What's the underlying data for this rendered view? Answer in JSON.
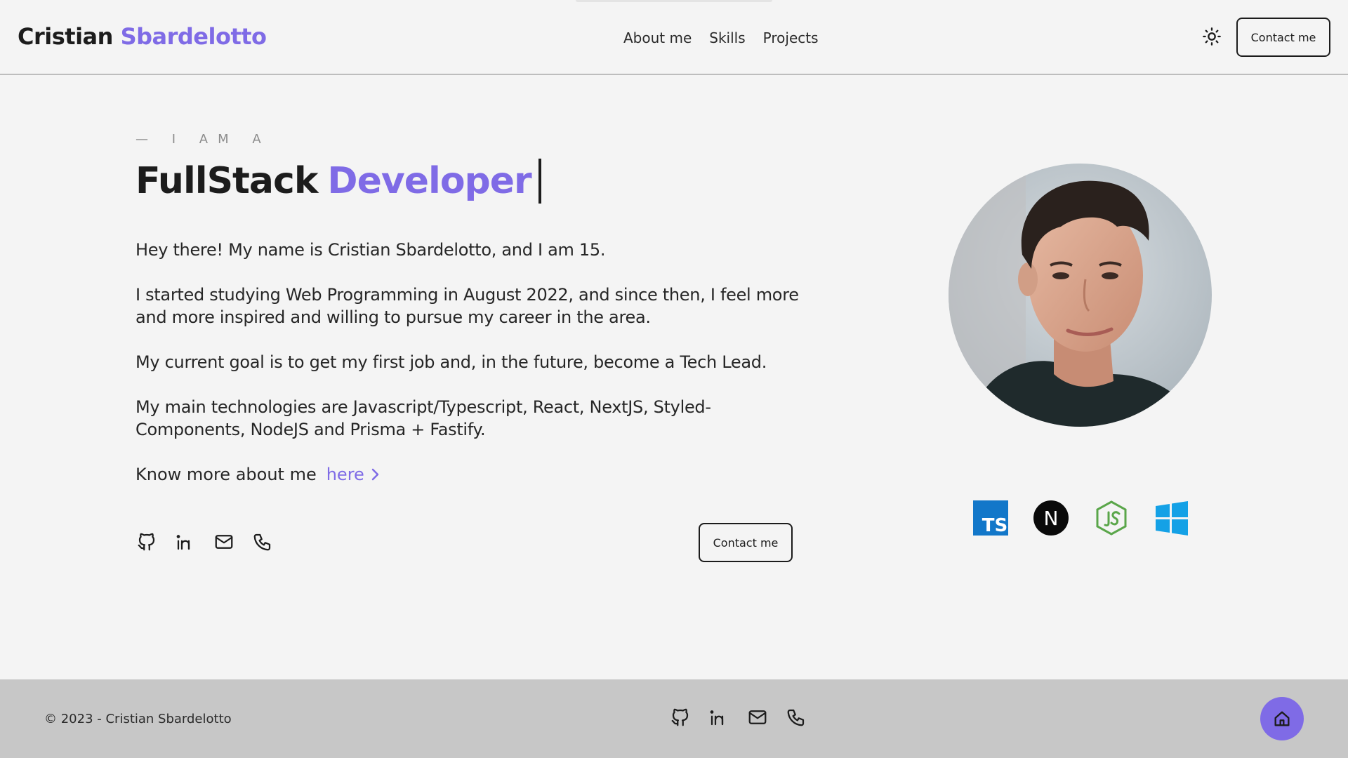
{
  "header": {
    "brand_first": "Cristian",
    "brand_last": "Sbardelotto",
    "nav": [
      {
        "label": "About me"
      },
      {
        "label": "Skills"
      },
      {
        "label": "Projects"
      }
    ],
    "theme_icon": "sun-icon",
    "contact_label": "Contact me"
  },
  "hero": {
    "eyebrow": "— I AM A",
    "title_main": "FullStack",
    "title_accent": "Developer",
    "paragraphs": [
      "Hey there! My name is Cristian Sbardelotto, and I am 15.",
      "I started studying Web Programming in August 2022, and since then, I feel more and more inspired and willing to pursue my career in the area.",
      "My current goal is to get my first job and, in the future, become a Tech Lead.",
      "My main technologies are Javascript/Typescript, React, NextJS, Styled-Components, NodeJS and Prisma + Fastify."
    ],
    "more_text": "Know more about me",
    "more_link": "here",
    "socials": [
      "github-icon",
      "linkedin-icon",
      "mail-icon",
      "phone-icon"
    ],
    "contact_label": "Contact me"
  },
  "photo": {
    "alt": "profile-photo"
  },
  "tech": {
    "icons": [
      "typescript-icon",
      "nextjs-icon",
      "nodejs-icon",
      "windows-icon"
    ],
    "ts_text": "TS",
    "next_text": "N"
  },
  "footer": {
    "copyright": "© 2023 - Cristian Sbardelotto",
    "socials": [
      "github-icon",
      "linkedin-icon",
      "mail-icon",
      "phone-icon"
    ],
    "home_icon": "home-icon"
  },
  "colors": {
    "accent": "#7f6be6",
    "background": "#f4f4f4",
    "footer": "#c7c7c7",
    "text": "#1c1c1c"
  }
}
